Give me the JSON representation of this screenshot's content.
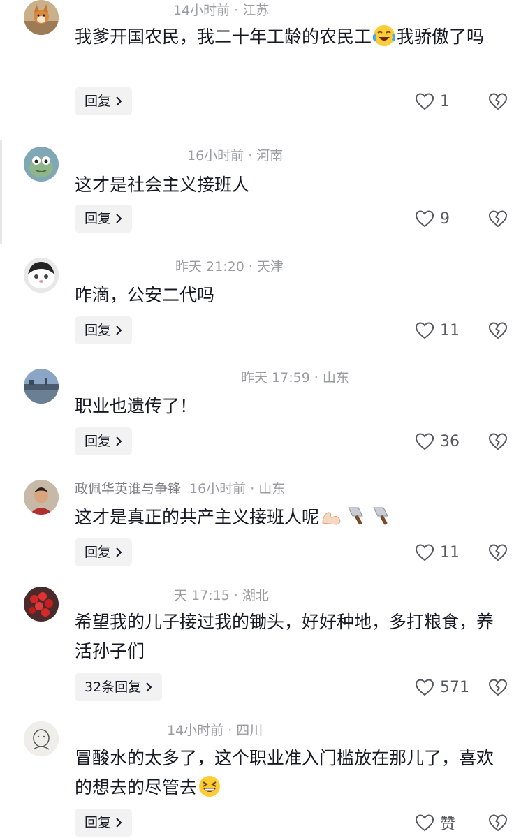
{
  "comments": [
    {
      "username": "",
      "time": "14小时前",
      "location": "江苏",
      "text": "我爹开国农民，我二十年工龄的农民工",
      "text_after_emoji": "我骄傲了吗",
      "emoji": "laughing-crying-emoji",
      "reply_label": "回复",
      "likes": "1"
    },
    {
      "username": "",
      "time": "16小时前",
      "location": "河南",
      "text": "这才是社会主义接班人",
      "reply_label": "回复",
      "likes": "9"
    },
    {
      "username": "",
      "time": "昨天 21:20",
      "location": "天津",
      "text": "咋滴，公安二代吗",
      "reply_label": "回复",
      "likes": "11"
    },
    {
      "username": "",
      "time": "昨天 17:59",
      "location": "山东",
      "text": "职业也遗传了！",
      "reply_label": "回复",
      "likes": "36"
    },
    {
      "username": "政佩华英谁与争锋",
      "time": "16小时前",
      "location": "山东",
      "text": "这才是真正的共产主义接班人呢",
      "emojis": [
        "flexed-biceps-emoji",
        "cleaver-emoji",
        "cleaver-emoji"
      ],
      "reply_label": "回复",
      "likes": "11"
    },
    {
      "username": "",
      "time": "天 17:15",
      "location": "湖北",
      "text": "希望我的儿子接过我的锄头，好好种地，多打粮食，养活孙子们",
      "reply_label": "32条回复",
      "likes": "571"
    },
    {
      "username": "",
      "time": "14小时前",
      "location": "四川",
      "text": "冒酸水的太多了，这个职业准入门槛放在那儿了，喜欢的想去的尽管去",
      "emoji": "grinning-squinting-emoji",
      "reply_label": "回复",
      "likes": "赞"
    }
  ],
  "icons": {
    "like": "heart-outline-icon",
    "dislike": "broken-heart-icon",
    "reply_chevron": "chevron-right-icon"
  },
  "colors": {
    "text": "#161823",
    "meta": "#9b9ca2",
    "button_bg": "#f2f2f3"
  }
}
